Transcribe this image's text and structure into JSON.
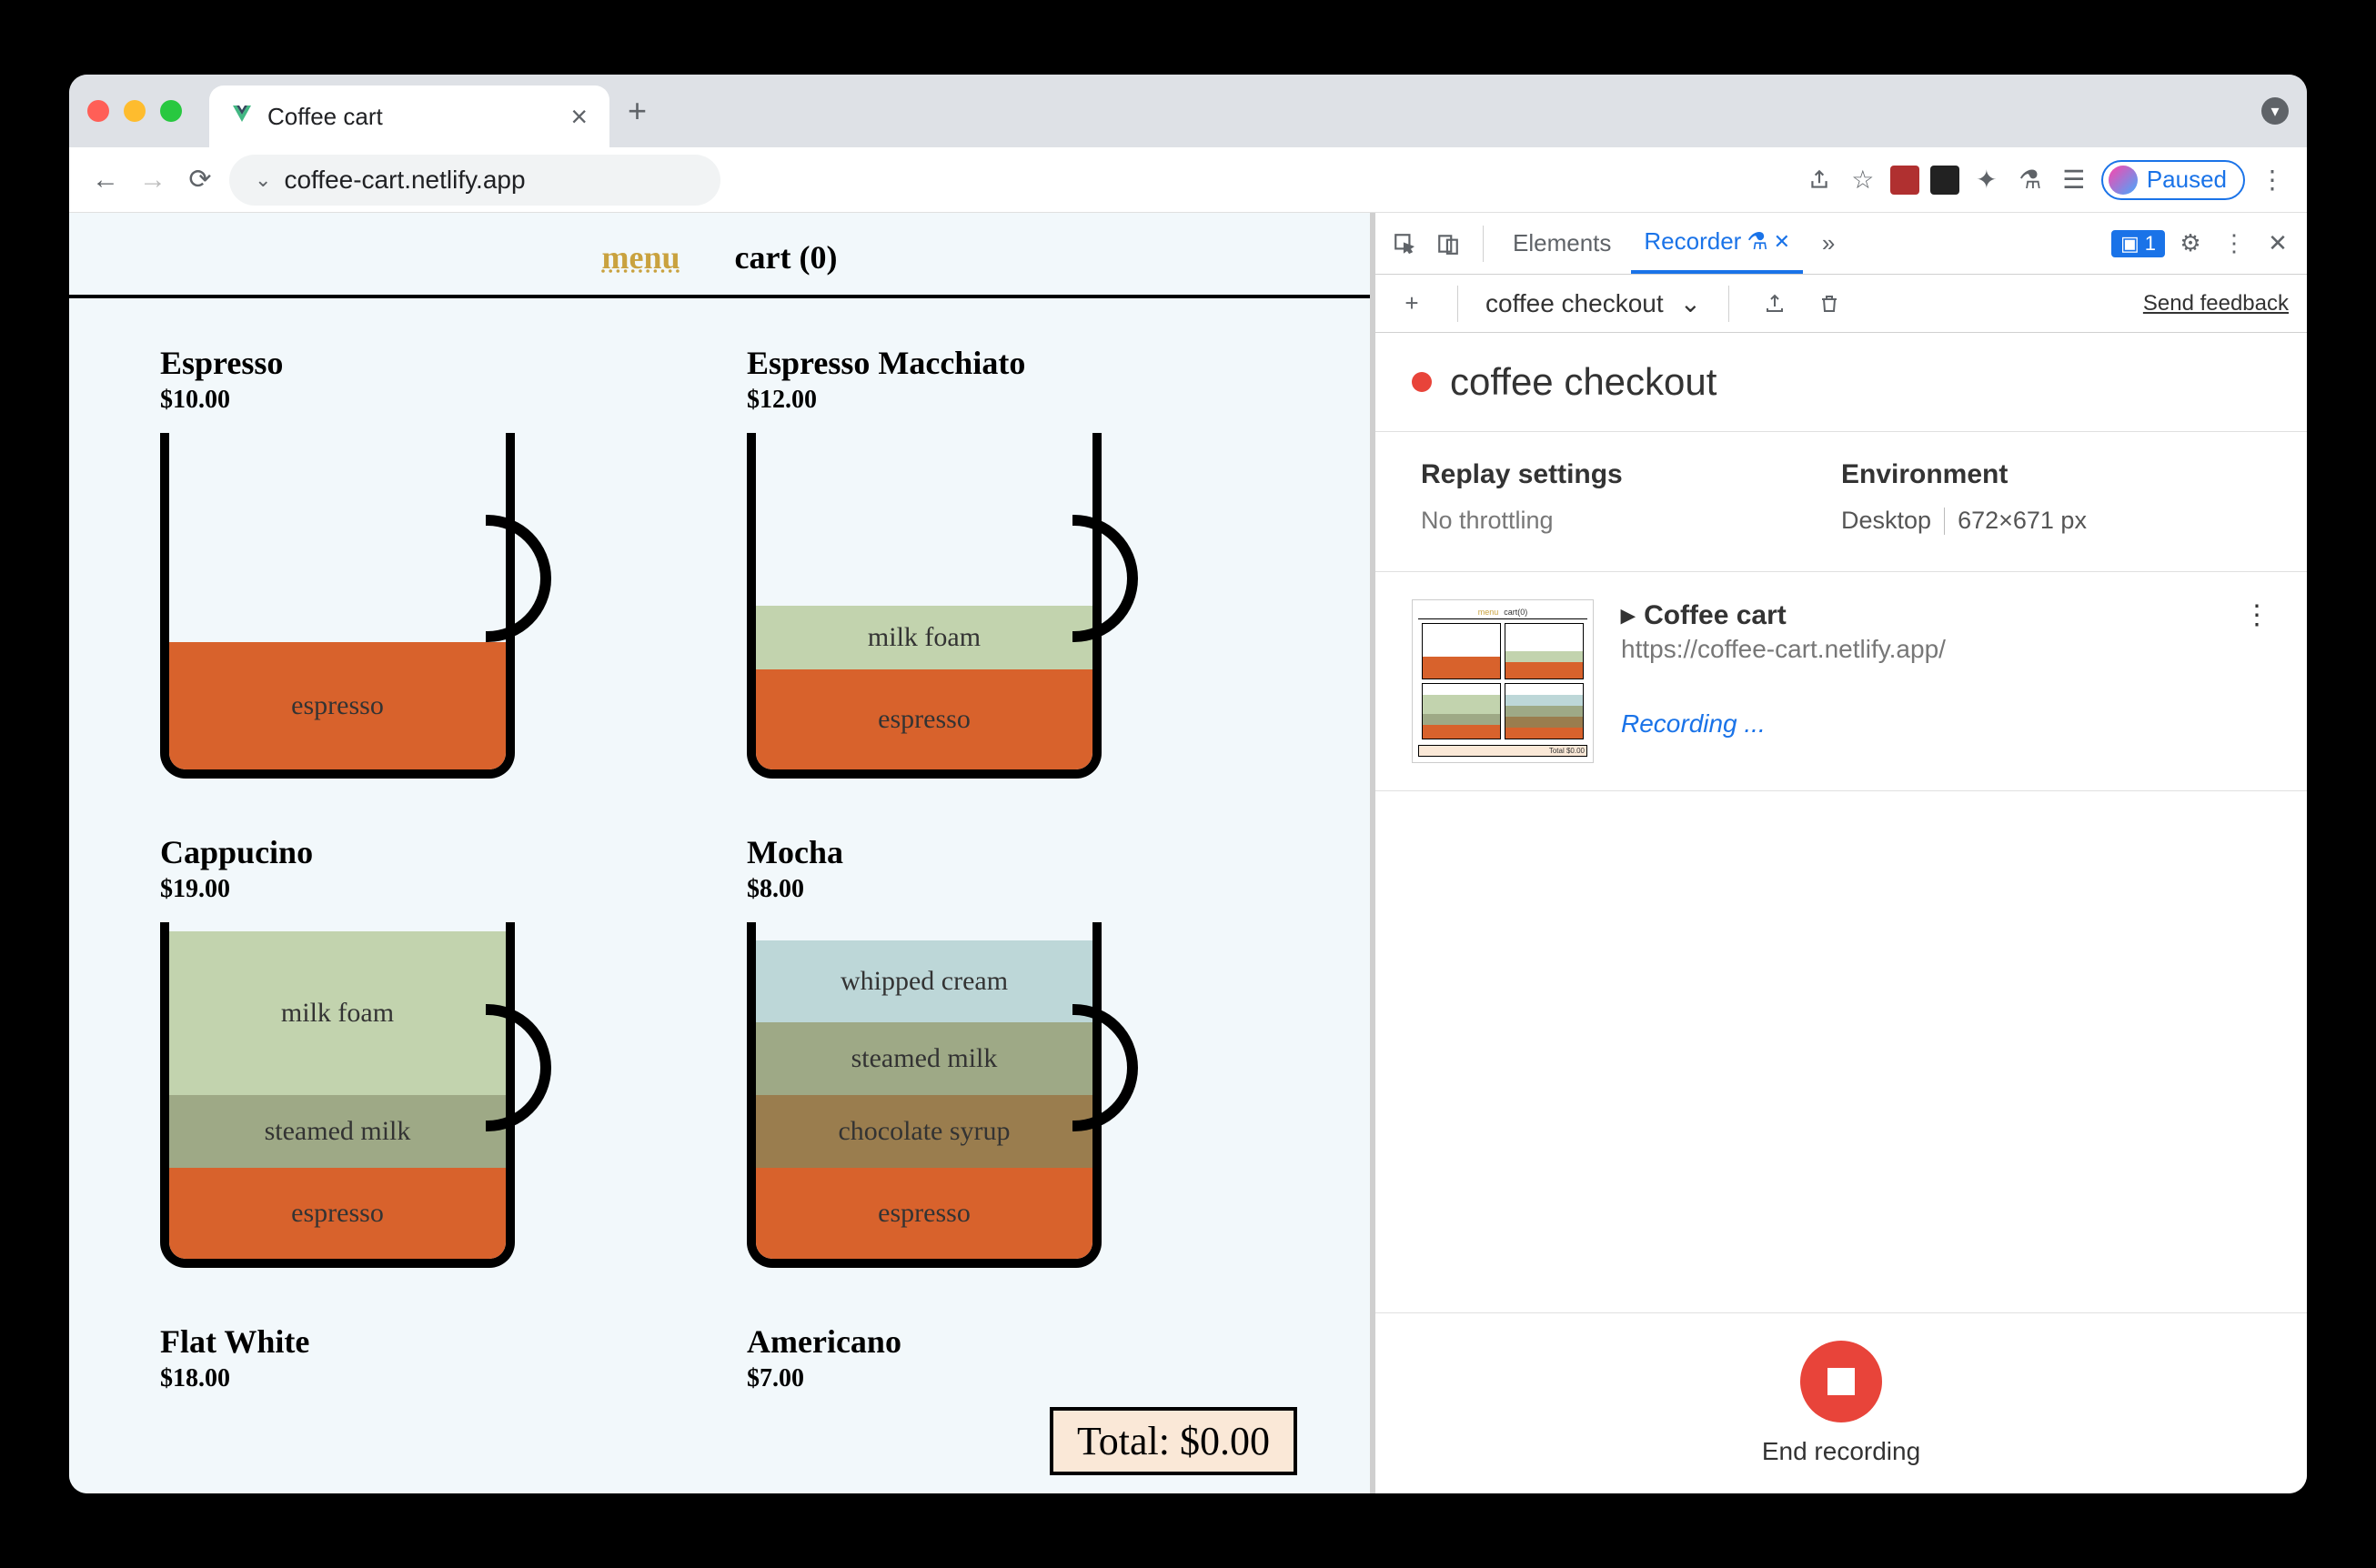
{
  "browser": {
    "tab_title": "Coffee cart",
    "url": "coffee-cart.netlify.app",
    "paused_label": "Paused"
  },
  "page": {
    "nav": {
      "menu": "menu",
      "cart": "cart (0)"
    },
    "total_label": "Total: $0.00",
    "products": [
      {
        "name": "Espresso",
        "price": "$10.00",
        "layers": [
          {
            "label": "espresso",
            "color": "#d8622c",
            "height": 140
          }
        ]
      },
      {
        "name": "Espresso Macchiato",
        "price": "$12.00",
        "layers": [
          {
            "label": "milk foam",
            "color": "#c2d3ae",
            "height": 70
          },
          {
            "label": "espresso",
            "color": "#d8622c",
            "height": 110
          }
        ]
      },
      {
        "name": "Cappucino",
        "price": "$19.00",
        "layers": [
          {
            "label": "milk foam",
            "color": "#c2d3ae",
            "height": 180
          },
          {
            "label": "steamed milk",
            "color": "#9ea986",
            "height": 80
          },
          {
            "label": "espresso",
            "color": "#d8622c",
            "height": 100
          }
        ]
      },
      {
        "name": "Mocha",
        "price": "$8.00",
        "layers": [
          {
            "label": "whipped cream",
            "color": "#bdd7d8",
            "height": 90
          },
          {
            "label": "steamed milk",
            "color": "#9ea986",
            "height": 80
          },
          {
            "label": "chocolate syrup",
            "color": "#9a7d4e",
            "height": 80
          },
          {
            "label": "espresso",
            "color": "#d8622c",
            "height": 100
          }
        ]
      },
      {
        "name": "Flat White",
        "price": "$18.00",
        "layers": []
      },
      {
        "name": "Americano",
        "price": "$7.00",
        "layers": []
      }
    ]
  },
  "devtools": {
    "tabs": {
      "elements": "Elements",
      "recorder": "Recorder"
    },
    "issue_count": "1",
    "toolbar": {
      "recording_name": "coffee checkout",
      "feedback": "Send feedback"
    },
    "title": "coffee checkout",
    "settings": {
      "replay_heading": "Replay settings",
      "throttling": "No throttling",
      "env_heading": "Environment",
      "env_device": "Desktop",
      "env_size": "672×671 px"
    },
    "step": {
      "title": "Coffee cart",
      "url": "https://coffee-cart.netlify.app/",
      "recording": "Recording ..."
    },
    "footer": {
      "end": "End recording"
    }
  }
}
